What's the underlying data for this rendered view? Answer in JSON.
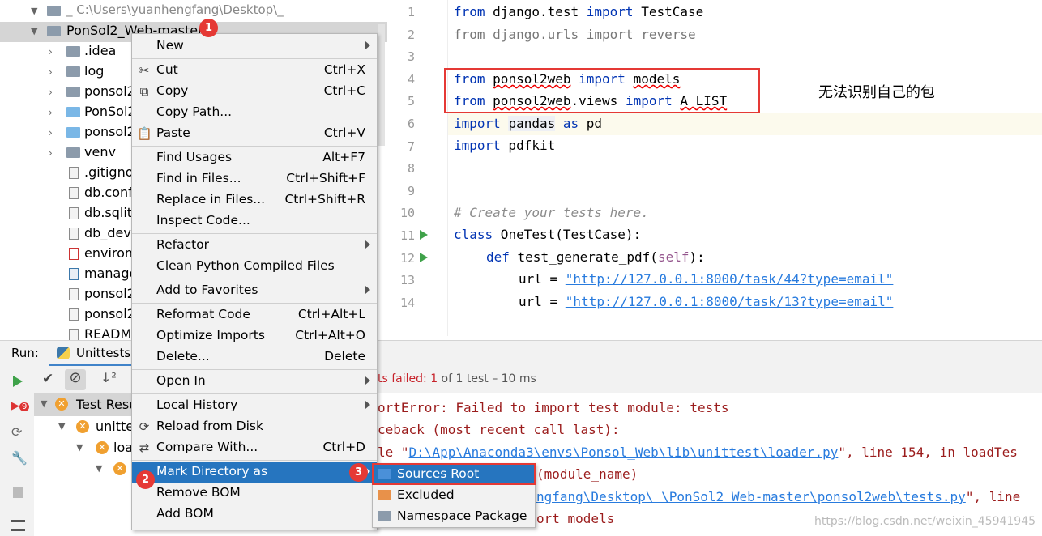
{
  "tree": {
    "root_label": "_  C:\\Users\\yuanhengfang\\Desktop\\_",
    "project_label": "PonSol2_Web-master",
    "items": [
      {
        "label": ".idea",
        "kind": "folder"
      },
      {
        "label": "log",
        "kind": "folder"
      },
      {
        "label": "ponsol2",
        "kind": "folder-pkg"
      },
      {
        "label": "PonSol2",
        "kind": "folder-blue"
      },
      {
        "label": "ponsol2",
        "kind": "folder-blue"
      },
      {
        "label": "venv",
        "kind": "folder"
      },
      {
        "label": ".gitigno",
        "kind": "file"
      },
      {
        "label": "db.confi",
        "kind": "file"
      },
      {
        "label": "db.sqlite",
        "kind": "file-db"
      },
      {
        "label": "db_dev.",
        "kind": "file"
      },
      {
        "label": "environ",
        "kind": "file-yml"
      },
      {
        "label": "manage",
        "kind": "file-py"
      },
      {
        "label": "ponsol2",
        "kind": "file"
      },
      {
        "label": "ponsol2",
        "kind": "file"
      },
      {
        "label": "README",
        "kind": "file"
      }
    ]
  },
  "editor": {
    "line_numbers": [
      "1",
      "2",
      "3",
      "4",
      "5",
      "6",
      "7",
      "8",
      "9",
      "10",
      "11",
      "12",
      "13",
      "14"
    ],
    "lines": {
      "l1": {
        "kw1": "from",
        "mod": " django.test ",
        "kw2": "import",
        "name": " TestCase"
      },
      "l2": {
        "text": "from django.urls import reverse"
      },
      "l4": {
        "kw1": "from",
        "mod": "ponsol2web",
        "kw2": "import",
        "name": "models"
      },
      "l5": {
        "kw1": "from",
        "mod": "ponsol2web",
        "mod2": ".views ",
        "kw2": "import",
        "name": "A_LIST"
      },
      "l6": {
        "kw1": "import",
        "mod": "pandas",
        "kw2": "as",
        "name": " pd"
      },
      "l7": {
        "kw1": "import",
        "name": " pdfkit"
      },
      "l10": {
        "comment": "# Create your tests here."
      },
      "l11": {
        "kw1": "class",
        "name": " OneTest(TestCase):"
      },
      "l12": {
        "kw1": "def",
        "name": " test_generate_pdf(",
        "self": "self",
        "end": "):"
      },
      "l13": {
        "var": "url = ",
        "str": "\"http://127.0.0.1:8000/task/44?type=email\""
      },
      "l14": {
        "var": "url = ",
        "str": "\"http://127.0.0.1:8000/task/13?type=email\""
      }
    },
    "annotation": "无法识别自己的包"
  },
  "run": {
    "label": "Run:",
    "tab_label": "Unittests",
    "status_prefix": "ts failed: ",
    "status_count": "1",
    "status_suffix": " of 1 test – 10 ms",
    "tree": {
      "root": "Test Resu",
      "child1": "unittes",
      "child2": "loa"
    },
    "output": {
      "o1": "ortError: Failed to import test module: tests",
      "o2": "ceback (most recent call last):",
      "o3_pre": "le \"",
      "o3_link": "D:\\App\\Anaconda3\\envs\\Ponsol_Web\\lib\\unittest\\loader.py",
      "o3_post": "\", line 154, in loadTes",
      "o4": "(module_name)",
      "o5_link": "ngfang\\Desktop\\_\\PonSol2_Web-master\\ponsol2web\\tests.py",
      "o5_post": "\", line",
      "o6": "ort models"
    }
  },
  "context_menu": {
    "items": [
      {
        "label": "New",
        "shortcut": "",
        "submenu": true
      },
      {
        "label": "Cut",
        "shortcut": "Ctrl+X"
      },
      {
        "label": "Copy",
        "shortcut": "Ctrl+C"
      },
      {
        "label": "Copy Path...",
        "shortcut": ""
      },
      {
        "label": "Paste",
        "shortcut": "Ctrl+V"
      },
      {
        "label": "Find Usages",
        "shortcut": "Alt+F7"
      },
      {
        "label": "Find in Files...",
        "shortcut": "Ctrl+Shift+F"
      },
      {
        "label": "Replace in Files...",
        "shortcut": "Ctrl+Shift+R"
      },
      {
        "label": "Inspect Code...",
        "shortcut": ""
      },
      {
        "label": "Refactor",
        "shortcut": "",
        "submenu": true
      },
      {
        "label": "Clean Python Compiled Files",
        "shortcut": ""
      },
      {
        "label": "Add to Favorites",
        "shortcut": "",
        "submenu": true
      },
      {
        "label": "Reformat Code",
        "shortcut": "Ctrl+Alt+L"
      },
      {
        "label": "Optimize Imports",
        "shortcut": "Ctrl+Alt+O"
      },
      {
        "label": "Delete...",
        "shortcut": "Delete"
      },
      {
        "label": "Open In",
        "shortcut": "",
        "submenu": true
      },
      {
        "label": "Local History",
        "shortcut": "",
        "submenu": true
      },
      {
        "label": "Reload from Disk",
        "shortcut": ""
      },
      {
        "label": "Compare With...",
        "shortcut": "Ctrl+D"
      },
      {
        "label": "Mark Directory as",
        "shortcut": "",
        "submenu": true,
        "selected": true
      },
      {
        "label": "Remove BOM",
        "shortcut": ""
      },
      {
        "label": "Add BOM",
        "shortcut": ""
      }
    ]
  },
  "submenu": {
    "items": [
      {
        "label": "Sources Root",
        "color": "#4a90d9",
        "selected": true
      },
      {
        "label": "Excluded",
        "color": "#e8914a"
      },
      {
        "label": "Namespace Package",
        "color": "#8c9bab"
      }
    ]
  },
  "badges": {
    "b1": "1",
    "b2": "2",
    "b3": "3"
  },
  "watermark": "https://blog.csdn.net/weixin_45941945",
  "colors": {
    "accent": "#2675bf",
    "annotation_red": "#e53935",
    "keyword": "#0033b3",
    "string": "#067d17"
  }
}
